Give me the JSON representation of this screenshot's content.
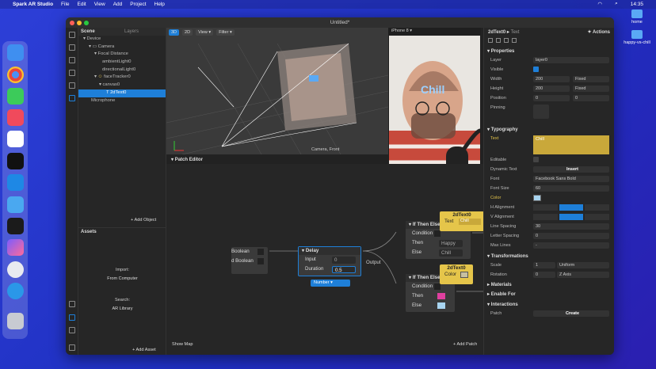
{
  "menubar": {
    "apple": "",
    "app": "Spark AR Studio",
    "items": [
      "File",
      "Edit",
      "View",
      "Add",
      "Project",
      "Help"
    ],
    "time": "14:35"
  },
  "desktop": {
    "folders": [
      "home",
      "happy-vs-chill"
    ]
  },
  "window": {
    "title": "Untitled*"
  },
  "scene": {
    "title": "Scene",
    "tab_layers": "Layers",
    "tree": [
      {
        "label": "Device",
        "indent": 1
      },
      {
        "label": "Camera",
        "indent": 2
      },
      {
        "label": "Focal Distance",
        "indent": 3
      },
      {
        "label": "ambientLight0",
        "indent": 4
      },
      {
        "label": "directionalLight0",
        "indent": 4
      },
      {
        "label": "faceTracker0",
        "indent": 3
      },
      {
        "label": "canvas0",
        "indent": 4
      },
      {
        "label": "2dText0",
        "indent": 5,
        "selected": true
      },
      {
        "label": "Microphone",
        "indent": 2
      }
    ],
    "add_object": "+ Add Object"
  },
  "assets": {
    "title": "Assets",
    "import_label": "Import:",
    "from_computer": "From Computer",
    "search_label": "Search:",
    "ar_library": "AR Library",
    "add_asset": "+ Add Asset"
  },
  "viewport": {
    "mode3d": "3D",
    "mode2d": "2D",
    "view": "View",
    "filter": "Filter",
    "caption": "Camera, Front"
  },
  "simulator": {
    "device": "iPhone 8",
    "face_text": "Chill"
  },
  "patch_editor": {
    "title": "Patch Editor",
    "show_map": "Show Map",
    "add_patch": "+ Add Patch",
    "output": "Output",
    "boolean_a": "Boolean",
    "boolean_b": "d Boolean",
    "delay": {
      "title": "Delay",
      "input": "Input",
      "input_val": "0",
      "duration": "Duration",
      "duration_val": "0.5",
      "type": "Number"
    },
    "ite1": {
      "title": "If Then Else",
      "condition": "Condition",
      "then": "Then",
      "then_val": "Happy",
      "else": "Else",
      "else_val": "Chill"
    },
    "ite2": {
      "title": "If Then Else",
      "condition": "Condition",
      "then": "Then",
      "else": "Else"
    },
    "text_patch": {
      "title": "2dText0",
      "port": "Text",
      "port_val": "Chill"
    },
    "color_patch": {
      "title": "2dText0",
      "port": "Color"
    }
  },
  "props": {
    "title": "2dText0",
    "subtitle": "Text",
    "actions": "Actions",
    "properties": "Properties",
    "layer_label": "Layer",
    "layer_val": "layer0",
    "visible_label": "Visible",
    "width_label": "Width",
    "width_val": "200",
    "width_mode": "Fixed",
    "height_label": "Height",
    "height_val": "200",
    "height_mode": "Fixed",
    "position_label": "Position",
    "pos_x": "0",
    "pos_y": "0",
    "pinning_label": "Pinning",
    "typography": "Typography",
    "text_label": "Text",
    "text_val": "Chill",
    "editable_label": "Editable",
    "dynamic_label": "Dynamic Text",
    "insert": "Insert",
    "font_label": "Font",
    "font_val": "Facebook Sans Bold",
    "fontsize_label": "Font Size",
    "fontsize_val": "60",
    "color_label": "Color",
    "halign_label": "H Alignment",
    "valign_label": "V Alignment",
    "linespacing_label": "Line Spacing",
    "linespacing_val": "30",
    "letterspacing_label": "Letter Spacing",
    "letterspacing_val": "0",
    "maxlines_label": "Max Lines",
    "maxlines_val": "-",
    "transformations": "Transformations",
    "scale_label": "Scale",
    "scale_val": "1",
    "scale_mode": "Uniform",
    "rotation_label": "Rotation",
    "rotation_val": "0",
    "rotation_axis": "Z Axis",
    "materials": "Materials",
    "enable_for": "Enable For",
    "interactions": "Interactions",
    "patch_label": "Patch",
    "create": "Create"
  },
  "colors": {
    "accent": "#1e7fd8",
    "patch_yellow": "#e5c54a",
    "pink": "#e040a0",
    "light_blue": "#a8d4f0"
  }
}
